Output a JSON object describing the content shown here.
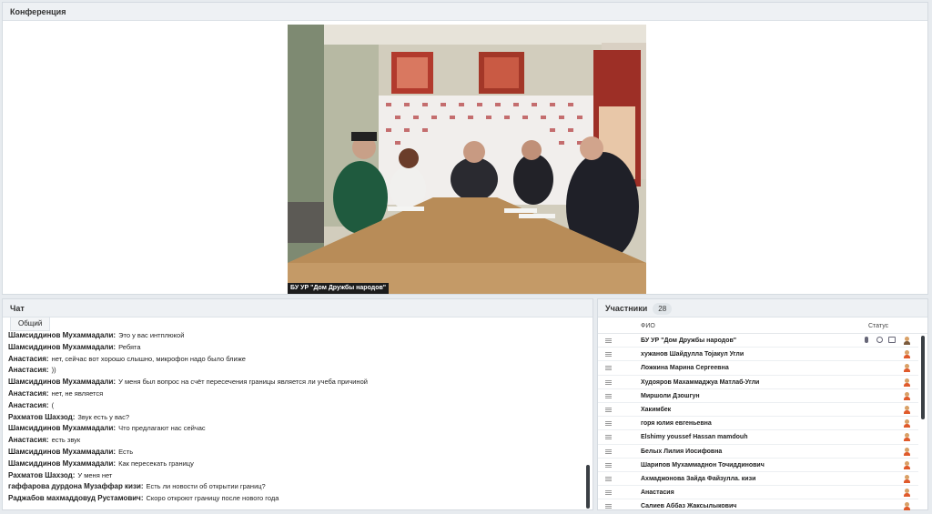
{
  "conference": {
    "title": "Конференция",
    "video_caption": "БУ УР \"Дом Дружбы народов\""
  },
  "chat": {
    "title": "Чат",
    "tab": "Общий",
    "messages": [
      {
        "author": "Шамсиддинов  Мухаммадали:",
        "text": "Это у вас интплюкой"
      },
      {
        "author": "Шамсиддинов  Мухаммадали:",
        "text": "Ребята"
      },
      {
        "author": "Анастасия:",
        "text": "нет, сейчас вот хорошо слышно, микрофон надо было ближе"
      },
      {
        "author": "Анастасия:",
        "text": "))"
      },
      {
        "author": "Шамсиддинов  Мухаммадали:",
        "text": "У меня был вопрос на счёт пересечения границы является ли учеба причиной"
      },
      {
        "author": "Анастасия:",
        "text": "нет, не является"
      },
      {
        "author": "Анастасия:",
        "text": "("
      },
      {
        "author": "Рахматов  Шахзод:",
        "text": "Звук есть у вас?"
      },
      {
        "author": "Шамсиддинов  Мухаммадали:",
        "text": "Что предлагают нас сейчас"
      },
      {
        "author": "Анастасия:",
        "text": "есть звук"
      },
      {
        "author": "Шамсиддинов  Мухаммадали:",
        "text": "Есть"
      },
      {
        "author": "Шамсиддинов  Мухаммадали:",
        "text": "Как пересекать границу"
      },
      {
        "author": "Рахматов  Шахзод:",
        "text": "У меня нет"
      },
      {
        "author": "гаффарова  дурдона Музаффар кизи:",
        "text": "Есть ли новости об открытии границ?"
      },
      {
        "author": "Раджабов  махмаддовуд  Рустамович:",
        "text": "Скоро откроют границу после нового года"
      }
    ]
  },
  "participants": {
    "title": "Участники",
    "count": "28",
    "col_name": "ФИО",
    "col_status": "Статус",
    "rows": [
      {
        "name": "БУ УР \"Дом Дружбы народов\"",
        "status_icons": [
          "mic-icon",
          "camera-icon",
          "screen-icon",
          "user-avatar-icon"
        ]
      },
      {
        "name": "хужанов  Шайдулла  Тоjакул Угли"
      },
      {
        "name": "Ложкина Марина  Сергеевна"
      },
      {
        "name": "Худояров Махаммаджуа  Матлаб-Угли"
      },
      {
        "name": "Миршоли  Дзошгун"
      },
      {
        "name": "Хакимбек"
      },
      {
        "name": "горя юлия  евгеньевна"
      },
      {
        "name": "Elshimy  youssef Hassan  mamdouh"
      },
      {
        "name": "Белых Лилия Иосифовна"
      },
      {
        "name": "Шарипов  Мухаммаднон  Точиддинович"
      },
      {
        "name": "Ахмаджонова  Зайда  Файзулла. кизи"
      },
      {
        "name": "Анастасия"
      },
      {
        "name": "Салиев  Аббаз  Жаксылыкович"
      }
    ]
  },
  "colors": {
    "header_bg": "#eef1f4",
    "avatar_orange": "#e05a2b"
  }
}
